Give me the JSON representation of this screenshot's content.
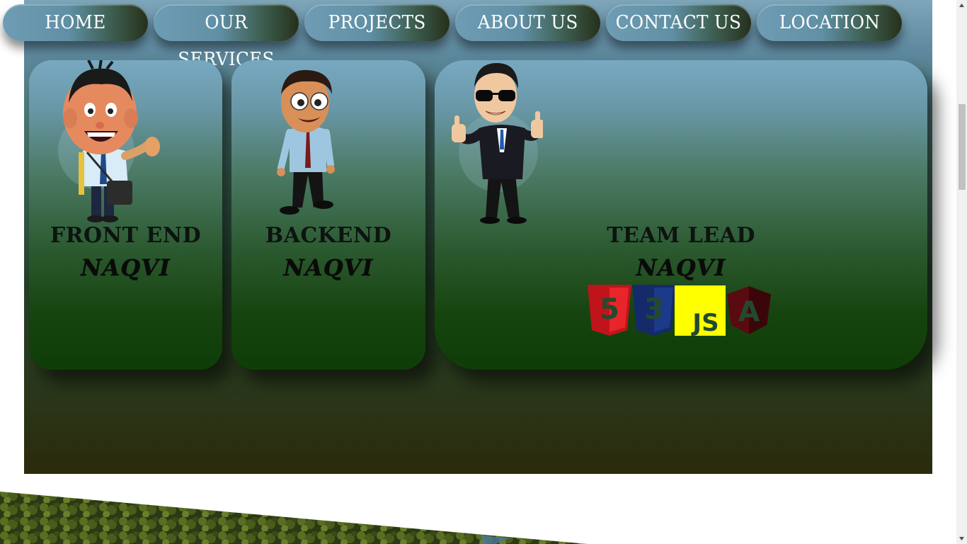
{
  "nav": {
    "items": [
      {
        "label": "HOME"
      },
      {
        "label": "OUR SERVICES"
      },
      {
        "label": "PROJECTS"
      },
      {
        "label": "ABOUT US"
      },
      {
        "label": "CONTACT US"
      },
      {
        "label": "LOCATION"
      }
    ]
  },
  "team": [
    {
      "role": "FRONT END",
      "name": "NAQVI",
      "avatar": "cartoon-man-waving-icon"
    },
    {
      "role": "BACKEND",
      "name": "NAQVI",
      "avatar": "cartoon-man-standing-icon"
    },
    {
      "role": "TEAM LEAD",
      "name": "NAQVI",
      "avatar": "businessman-thumbs-up-icon"
    }
  ],
  "tech_stack": [
    {
      "icon": "html5-icon",
      "label": "5",
      "color": "#c0141c"
    },
    {
      "icon": "css3-icon",
      "label": "3",
      "color": "#152a6b"
    },
    {
      "icon": "javascript-icon",
      "label": "JS",
      "color": "#ffff00"
    },
    {
      "icon": "angular-icon",
      "label": "A",
      "color": "#5a0a10"
    }
  ],
  "colors": {
    "nav_text": "#ffffff",
    "card_top": "#78a9c1",
    "card_bottom": "#0f3d07"
  }
}
